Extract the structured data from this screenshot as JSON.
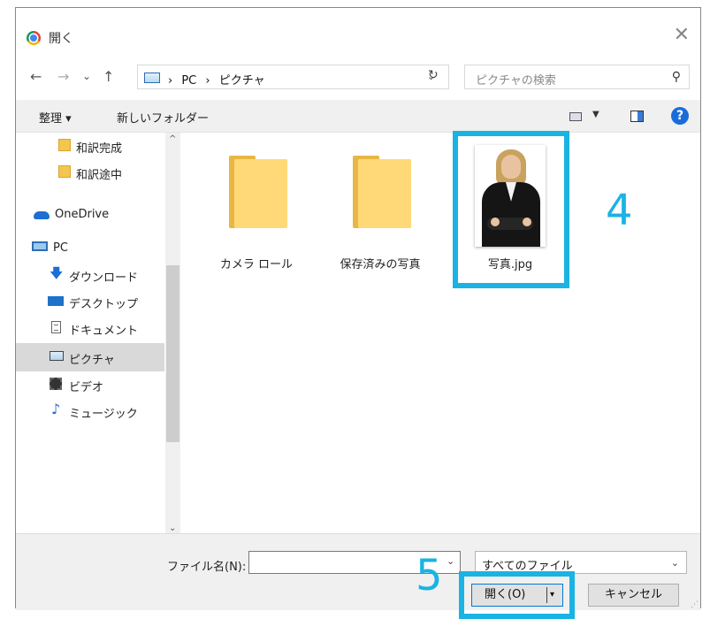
{
  "window": {
    "title": "開く",
    "close_glyph": "✕"
  },
  "nav": {
    "back": "←",
    "forward": "→",
    "recent": "⌄",
    "up": "↑",
    "breadcrumb": [
      "PC",
      "ピクチャ"
    ],
    "separator": "›",
    "refresh": "↻",
    "search_placeholder": "ピクチャの検索",
    "search_icon": "⚲"
  },
  "toolbar": {
    "organize": "整理 ▾",
    "new_folder": "新しいフォルダー",
    "view_dd": "▼",
    "help": "?"
  },
  "sidebar": {
    "items": [
      {
        "label": "和訳完成",
        "icon": "folder-icon"
      },
      {
        "label": "和訳途中",
        "icon": "folder-icon"
      },
      {
        "label": "OneDrive",
        "icon": "cloud-icon"
      },
      {
        "label": "PC",
        "icon": "computer-icon"
      },
      {
        "label": "ダウンロード",
        "icon": "download-icon"
      },
      {
        "label": "デスクトップ",
        "icon": "desktop-icon"
      },
      {
        "label": "ドキュメント",
        "icon": "document-icon"
      },
      {
        "label": "ピクチャ",
        "icon": "pictures-icon",
        "selected": true
      },
      {
        "label": "ビデオ",
        "icon": "video-icon"
      },
      {
        "label": "ミュージック",
        "icon": "music-icon"
      }
    ],
    "scroll_up": "^",
    "scroll_down": "⌄"
  },
  "files": [
    {
      "name": "カメラ ロール",
      "type": "folder"
    },
    {
      "name": "保存済みの写真",
      "type": "folder"
    },
    {
      "name": "写真.jpg",
      "type": "image",
      "selected": true
    }
  ],
  "footer": {
    "filename_label": "ファイル名(N):",
    "filename_value": "",
    "filename_dd": "⌄",
    "filter_value": "すべてのファイル",
    "filter_dd": "⌄",
    "open_label": "開く(O)",
    "open_split_arrow": "▾",
    "cancel_label": "キャンセル"
  },
  "annotations": {
    "step4": "4",
    "step5": "5",
    "color": "#1ab3e3"
  }
}
